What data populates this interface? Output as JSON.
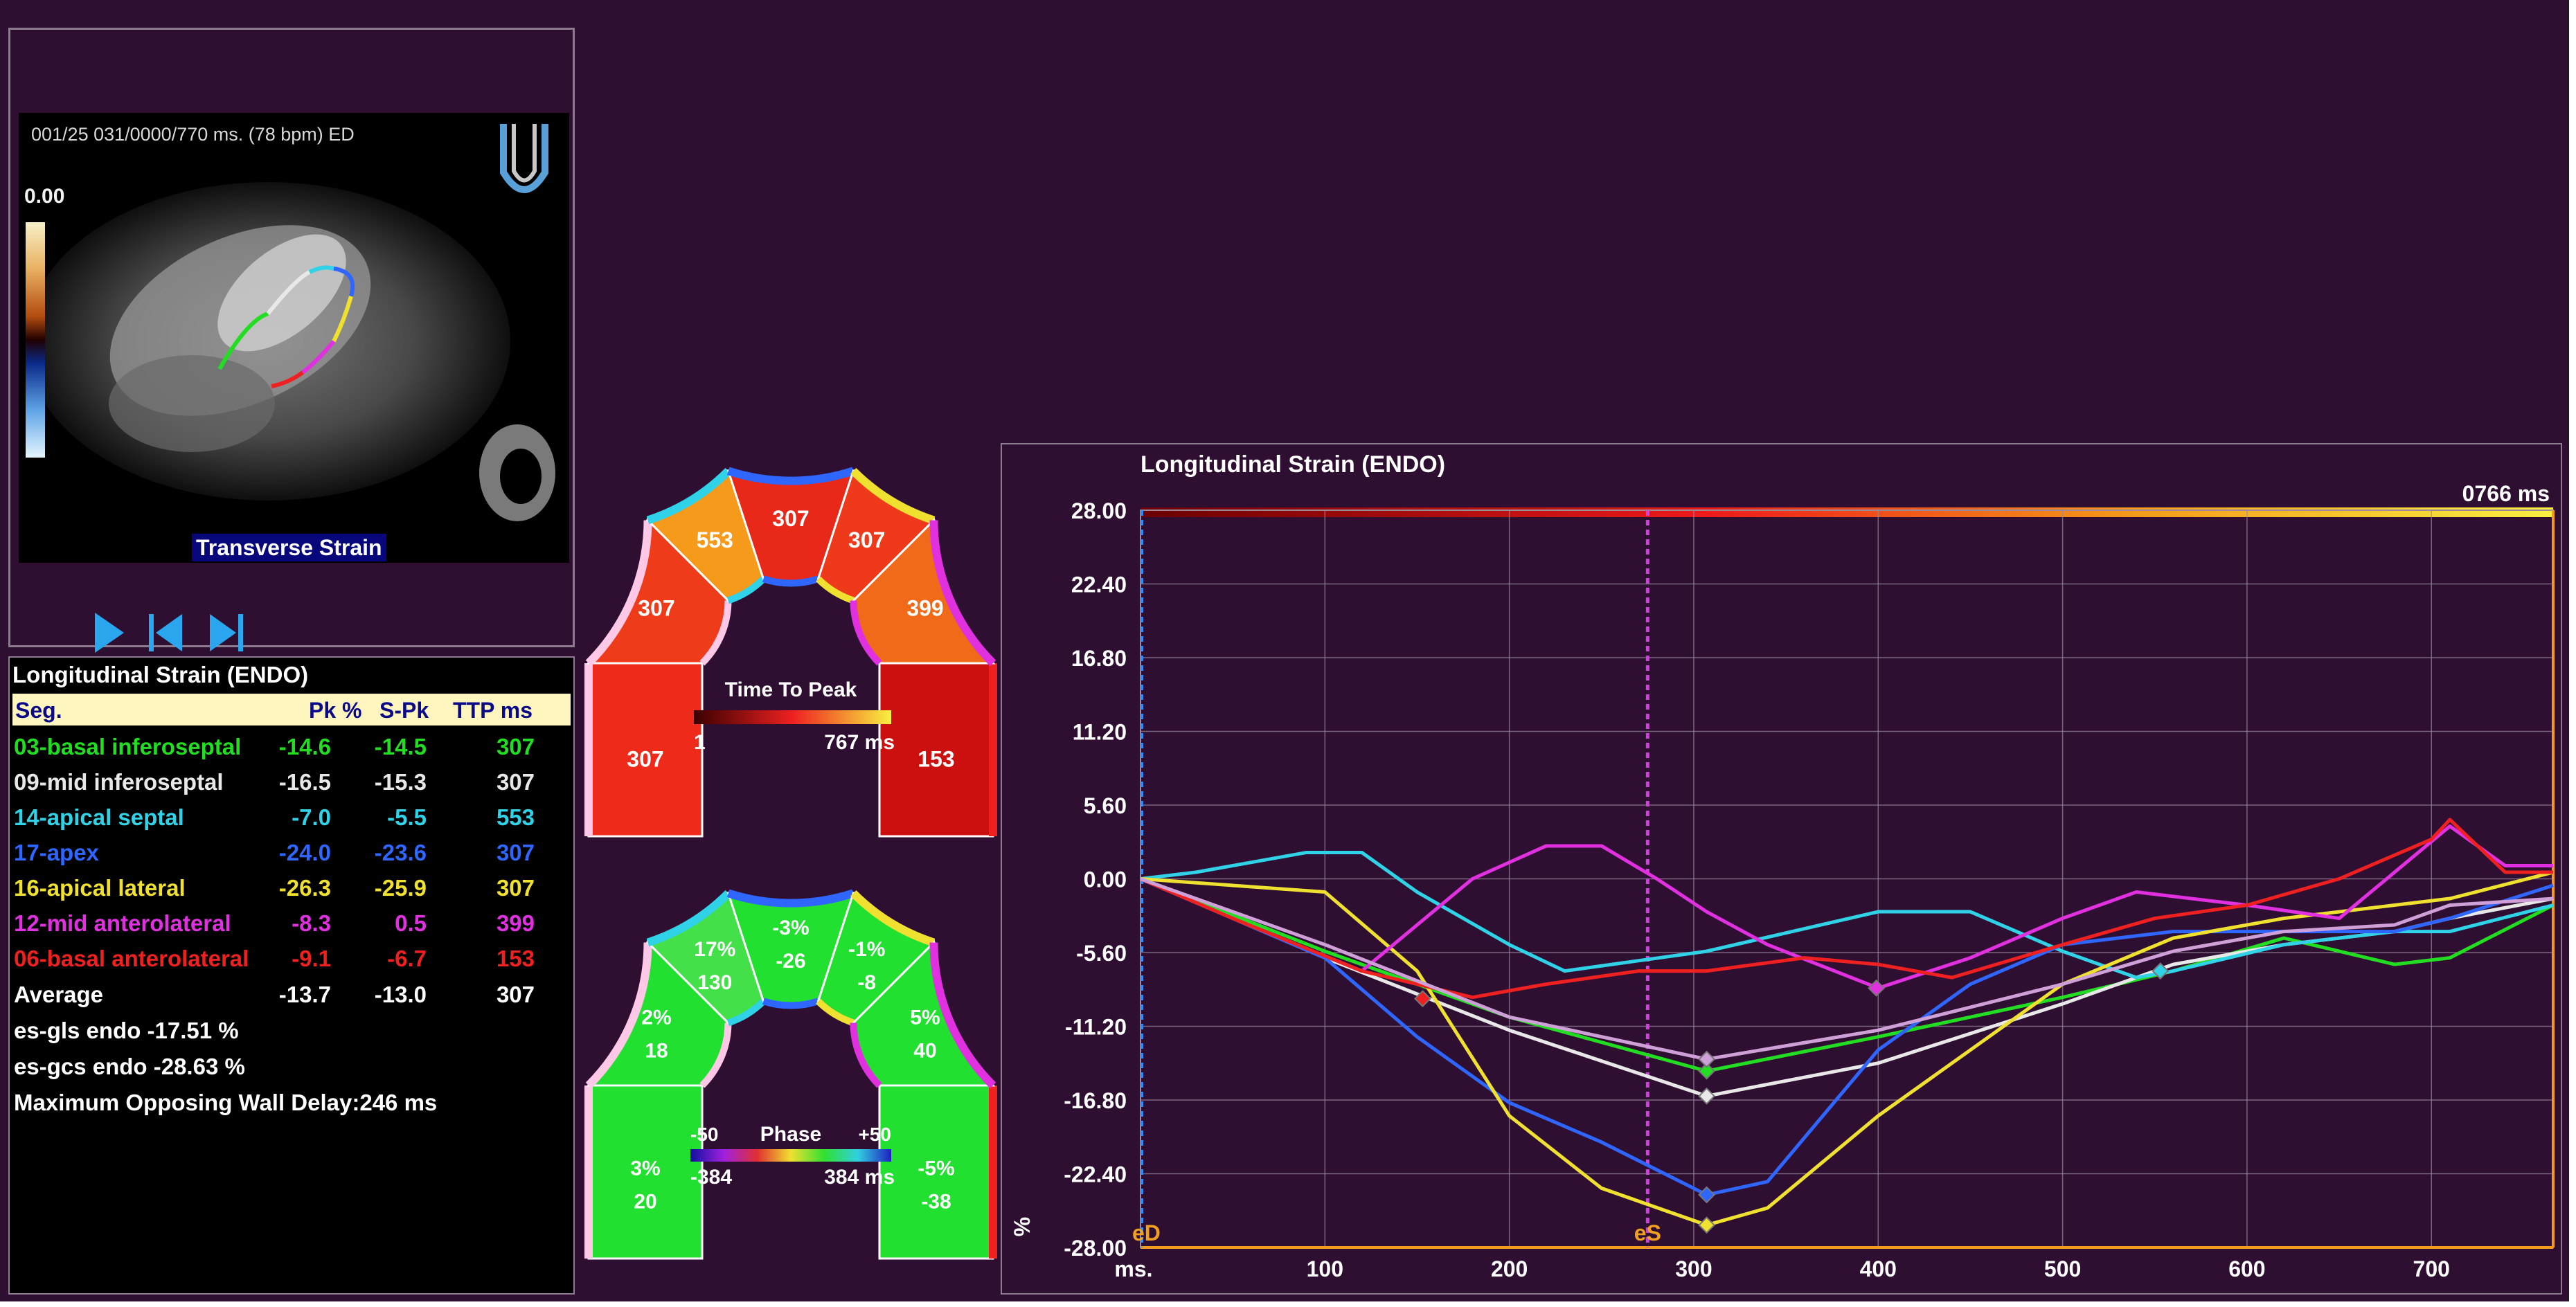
{
  "viewer": {
    "header_info": "001/25  031/0000/770 ms.  (78 bpm) ED",
    "scale_value": "0.00",
    "mode_label": "Transverse Strain",
    "controls": {
      "play_icon": "play-icon",
      "prev_icon": "skip-back-icon",
      "next_icon": "skip-forward-icon"
    },
    "orientation_icon": "heart-orientation-icon"
  },
  "segments_table": {
    "title": "Longitudinal Strain (ENDO)",
    "headers": {
      "seg": "Seg.",
      "pk": "Pk %",
      "spk": "S-Pk",
      "ttp": "TTP ms"
    },
    "rows": [
      {
        "seg": "03-basal inferoseptal",
        "pk": "-14.6",
        "spk": "-14.5",
        "ttp": "307",
        "color": "#22dd22"
      },
      {
        "seg": "09-mid inferoseptal",
        "pk": "-16.5",
        "spk": "-15.3",
        "ttp": "307",
        "color": "#e8e8e8"
      },
      {
        "seg": "14-apical septal",
        "pk": "-7.0",
        "spk": "-5.5",
        "ttp": "553",
        "color": "#2fd2e6"
      },
      {
        "seg": "17-apex",
        "pk": "-24.0",
        "spk": "-23.6",
        "ttp": "307",
        "color": "#2f66ff"
      },
      {
        "seg": "16-apical lateral",
        "pk": "-26.3",
        "spk": "-25.9",
        "ttp": "307",
        "color": "#f0e030"
      },
      {
        "seg": "12-mid anterolateral",
        "pk": "-8.3",
        "spk": "0.5",
        "ttp": "399",
        "color": "#e030e0"
      },
      {
        "seg": "06-basal anterolateral",
        "pk": "-9.1",
        "spk": "-6.7",
        "ttp": "153",
        "color": "#ee2020"
      }
    ],
    "average": {
      "seg": "Average",
      "pk": "-13.7",
      "spk": "-13.0",
      "ttp": "307"
    },
    "gls": "es-gls endo -17.51 %",
    "gcs": "es-gcs endo -28.63 %",
    "delay": "Maximum Opposing Wall Delay:246 ms"
  },
  "bullseye_ttp": {
    "outer": [
      "307",
      "307",
      "553",
      "307",
      "307",
      "399",
      "153"
    ],
    "legend_title": "Time To Peak",
    "legend_min": "1",
    "legend_max": "767 ms"
  },
  "bullseye_phase": {
    "outer": [
      {
        "pct": "3%",
        "val": "20"
      },
      {
        "pct": "2%",
        "val": "18"
      },
      {
        "pct": "17%",
        "val": "130"
      },
      {
        "pct": "-3%",
        "val": "-26"
      },
      {
        "pct": "-1%",
        "val": "-8"
      },
      {
        "pct": "5%",
        "val": "40"
      },
      {
        "pct": "-5%",
        "val": "-38"
      }
    ],
    "legend_title": "Phase",
    "legend_left": "-50",
    "legend_right": "+50",
    "legend_min": "-384",
    "legend_max": "384 ms"
  },
  "chart_data": {
    "type": "line",
    "title": "Longitudinal Strain (ENDO)",
    "time_label": "0766 ms",
    "ylabel": "%",
    "xlabel": "ms.",
    "xlim": [
      0,
      766
    ],
    "ylim": [
      -28,
      28
    ],
    "x_ticks": [
      100,
      200,
      300,
      400,
      500,
      600,
      700
    ],
    "y_ticks": [
      "28.00",
      "22.40",
      "16.80",
      "11.20",
      "5.60",
      "0.00",
      "-5.60",
      "-11.20",
      "-16.80",
      "-22.40",
      "-28.00"
    ],
    "markers": [
      {
        "label": "eD",
        "x": 0
      },
      {
        "label": "eS",
        "x": 275
      }
    ],
    "grid": true,
    "series": [
      {
        "name": "03-basal inferoseptal",
        "color": "#22dd22",
        "x": [
          0,
          100,
          200,
          307,
          400,
          500,
          560,
          620,
          680,
          710,
          766
        ],
        "y": [
          0,
          -5.5,
          -10.5,
          -14.6,
          -12,
          -9,
          -7,
          -4.5,
          -6.5,
          -6,
          -2
        ]
      },
      {
        "name": "09-mid inferoseptal",
        "color": "#e8e8e8",
        "x": [
          0,
          100,
          200,
          307,
          400,
          500,
          560,
          620,
          680,
          710,
          766
        ],
        "y": [
          0,
          -6,
          -11.5,
          -16.5,
          -14,
          -9.5,
          -6.5,
          -5,
          -4,
          -3,
          -1.5
        ]
      },
      {
        "name": "14-apical septal",
        "color": "#2fd2e6",
        "x": [
          0,
          30,
          90,
          120,
          150,
          200,
          230,
          307,
          400,
          450,
          500,
          540,
          560,
          620,
          680,
          710,
          766
        ],
        "y": [
          0,
          0.5,
          2,
          2,
          -1,
          -5,
          -7,
          -5.5,
          -2.5,
          -2.5,
          -5.5,
          -7.5,
          -7,
          -5,
          -4,
          -4,
          -2
        ]
      },
      {
        "name": "17-apex",
        "color": "#2f66ff",
        "x": [
          0,
          100,
          150,
          200,
          250,
          307,
          340,
          400,
          450,
          500,
          560,
          620,
          680,
          710,
          766
        ],
        "y": [
          0,
          -6,
          -12,
          -17,
          -20,
          -24,
          -23,
          -13,
          -8,
          -5,
          -4,
          -4,
          -4,
          -3,
          -0.5
        ]
      },
      {
        "name": "16-apical lateral",
        "color": "#f0e030",
        "x": [
          0,
          100,
          150,
          200,
          250,
          307,
          340,
          400,
          450,
          500,
          560,
          620,
          680,
          710,
          766
        ],
        "y": [
          0,
          -1,
          -7,
          -18,
          -23.5,
          -26.3,
          -25,
          -18,
          -13,
          -8,
          -4.5,
          -3,
          -2,
          -1.5,
          0.5
        ]
      },
      {
        "name": "12-mid anterolateral",
        "color": "#e030e0",
        "x": [
          0,
          50,
          120,
          180,
          220,
          250,
          280,
          307,
          340,
          400,
          450,
          500,
          540,
          600,
          650,
          710,
          740,
          766
        ],
        "y": [
          0,
          -3,
          -7,
          0,
          2.5,
          2.5,
          0,
          -2.5,
          -5,
          -8.3,
          -6,
          -3,
          -1,
          -2,
          -3,
          4,
          1,
          1
        ]
      },
      {
        "name": "06-basal anterolateral",
        "color": "#ee2020",
        "x": [
          0,
          50,
          120,
          180,
          220,
          270,
          307,
          360,
          400,
          440,
          500,
          550,
          600,
          650,
          700,
          710,
          740,
          766
        ],
        "y": [
          0,
          -3,
          -7,
          -9,
          -8,
          -7,
          -7,
          -6,
          -6.5,
          -7.5,
          -5,
          -3,
          -2,
          0,
          3,
          4.5,
          0.5,
          0.5
        ]
      },
      {
        "name": "Average",
        "color": "#cfa0d8",
        "x": [
          0,
          100,
          200,
          307,
          400,
          500,
          560,
          620,
          680,
          710,
          766
        ],
        "y": [
          0,
          -5,
          -10.5,
          -13.7,
          -11.5,
          -8,
          -5.5,
          -4,
          -3.5,
          -2,
          -1.5
        ]
      }
    ]
  }
}
